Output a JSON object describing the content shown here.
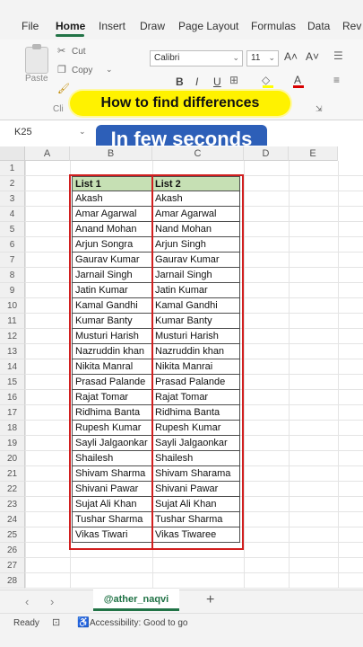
{
  "ribbon_tabs": [
    "File",
    "Home",
    "Insert",
    "Draw",
    "Page Layout",
    "Formulas",
    "Data",
    "Rev"
  ],
  "active_tab": "Home",
  "clipboard": {
    "paste_label": "Paste",
    "cut_label": "Cut",
    "copy_label": "Copy",
    "group_label": "Cli"
  },
  "font": {
    "name": "Calibri",
    "size": "11",
    "bold": "B",
    "italic": "I",
    "underline": "U",
    "grow": "A˄",
    "shrink": "A˅"
  },
  "overlay": {
    "banner_top": "How to find differences",
    "banner_bottom": "In few seconds"
  },
  "name_box": "K25",
  "columns": [
    "A",
    "B",
    "C",
    "D",
    "E"
  ],
  "rows": [
    "1",
    "2",
    "3",
    "4",
    "5",
    "6",
    "7",
    "8",
    "9",
    "10",
    "11",
    "12",
    "13",
    "14",
    "15",
    "16",
    "17",
    "18",
    "19",
    "20",
    "21",
    "22",
    "23",
    "24",
    "25",
    "26",
    "27",
    "28"
  ],
  "table": {
    "headers": [
      "List 1",
      "List 2"
    ],
    "rows": [
      [
        "Akash",
        "Akash"
      ],
      [
        "Amar Agarwal",
        "Amar Agarwal"
      ],
      [
        "Anand Mohan",
        "Nand Mohan"
      ],
      [
        "Arjun Songra",
        "Arjun Singh"
      ],
      [
        "Gaurav Kumar",
        "Gaurav Kumar"
      ],
      [
        "Jarnail Singh",
        "Jarnail Singh"
      ],
      [
        "Jatin Kumar",
        "Jatin Kumar"
      ],
      [
        "Kamal Gandhi",
        "Kamal Gandhi"
      ],
      [
        "Kumar Banty",
        "Kumar Banty"
      ],
      [
        "Musturi Harish",
        "Musturi Harish"
      ],
      [
        "Nazruddin khan",
        "Nazruddin khan"
      ],
      [
        "Nikita Manral",
        "Nikita Manrai"
      ],
      [
        "Prasad Palande",
        "Prasad Palande"
      ],
      [
        "Rajat Tomar",
        "Rajat Tomar"
      ],
      [
        "Ridhima Banta",
        "Ridhima Banta"
      ],
      [
        "Rupesh Kumar",
        "Rupesh Kumar"
      ],
      [
        "Sayli Jalgaonkar",
        "Sayli Jalgaonkar"
      ],
      [
        "Shailesh",
        "Shailesh"
      ],
      [
        "Shivam Sharma",
        "Shivam Sharama"
      ],
      [
        "Shivani Pawar",
        "Shivani Pawar"
      ],
      [
        "Sujat Ali Khan",
        "Sujat Ali Khan"
      ],
      [
        "Tushar Sharma",
        "Tushar Sharma"
      ],
      [
        "Vikas Tiwari",
        "Vikas Tiwaree"
      ]
    ]
  },
  "sheet_tab": "@ather_naqvi",
  "status": {
    "ready": "Ready",
    "accessibility": "Accessibility: Good to go"
  },
  "colors": {
    "header_fill": "#c6e0b4",
    "highlight_box": "#d11f1f",
    "banner_yellow": "#fff200",
    "banner_blue": "#2d5fb8",
    "excel_green": "#217346"
  }
}
